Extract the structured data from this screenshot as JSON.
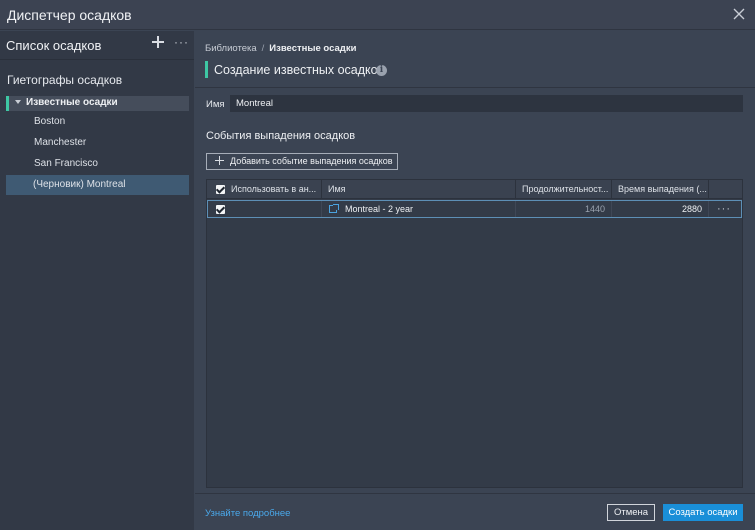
{
  "window": {
    "title": "Диспетчер осадков",
    "close_icon": "close-icon"
  },
  "sidebar": {
    "header": "Список осадков",
    "add_icon": "plus-icon",
    "more_label": "···",
    "section_title": "Гиетографы осадков",
    "group": {
      "label": "Известные осадки",
      "expanded": true,
      "accent": "#3ec7a4"
    },
    "items": [
      {
        "label": "Boston"
      },
      {
        "label": "Manchester"
      },
      {
        "label": "San Francisco"
      },
      {
        "label": "(Черновик) Montreal",
        "selected": true
      }
    ]
  },
  "main": {
    "breadcrumb": {
      "root": "Библиотека",
      "separator": "/",
      "current": "Известные осадки"
    },
    "title": "Создание известных осадков",
    "info_icon": "i",
    "name_label": "Имя",
    "name_value": "Montreal",
    "events_title": "События выпадения осадков",
    "add_event_label": "Добавить событие выпадения осадков",
    "table": {
      "columns": [
        "Использовать в ан...",
        "Имя",
        "Продолжительност...",
        "Время выпадения (..."
      ],
      "rows": [
        {
          "use": true,
          "name": "Montreal - 2 year",
          "duration": "1440",
          "time": "2880",
          "more": "···"
        }
      ]
    },
    "footer": {
      "learn_more": "Узнайте подробнее",
      "cancel_label": "Отмена",
      "create_label": "Создать осадки"
    }
  },
  "colors": {
    "accent": "#3ec7a4",
    "primary_button": "#1a8fd8",
    "selection": "#3f5a73",
    "link": "#4aa8ea"
  }
}
